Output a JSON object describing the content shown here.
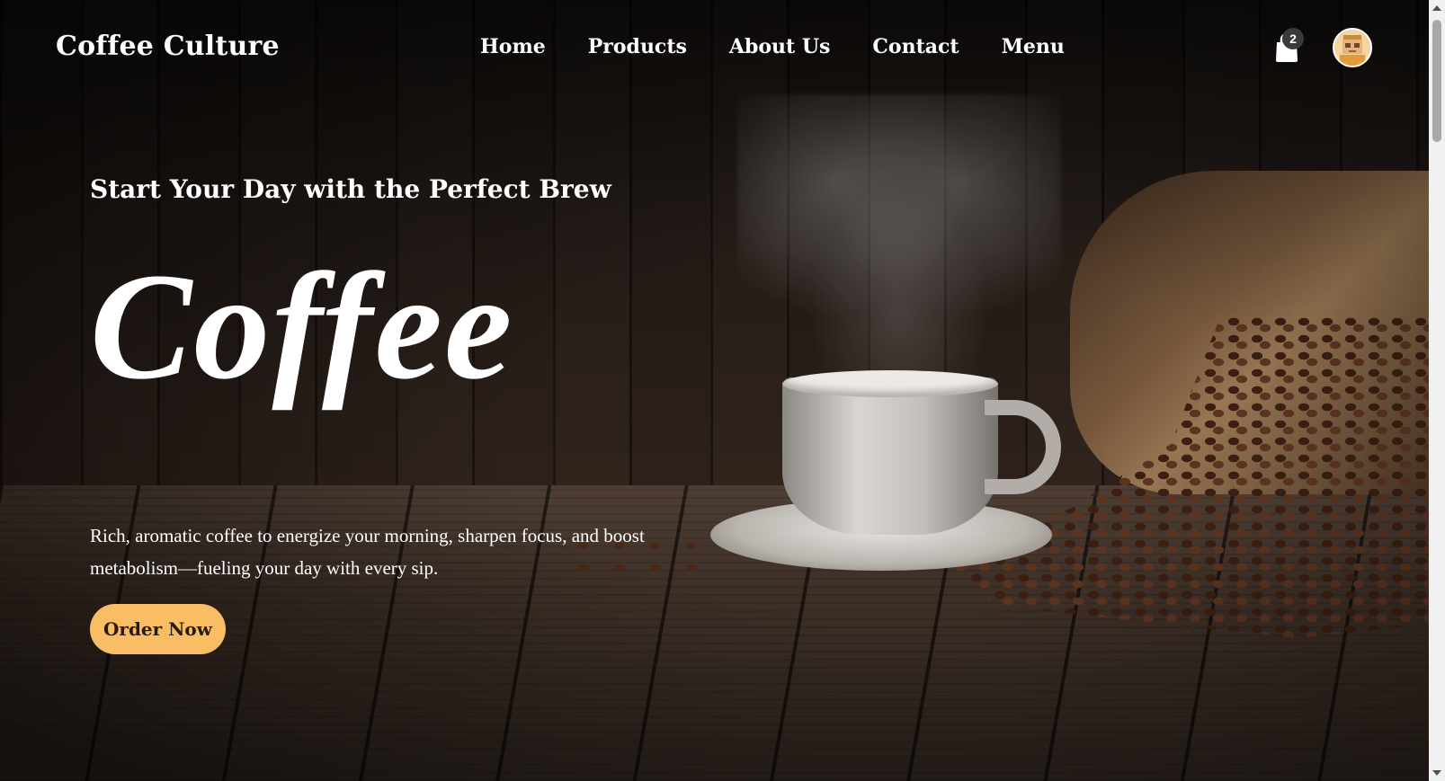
{
  "brand": {
    "name": "Coffee Culture"
  },
  "nav": {
    "items": [
      {
        "label": "Home"
      },
      {
        "label": "Products"
      },
      {
        "label": "About Us"
      },
      {
        "label": "Contact"
      },
      {
        "label": "Menu"
      }
    ]
  },
  "cart": {
    "count": "2",
    "icon": "shopping-bag-icon"
  },
  "user": {
    "avatar_icon": "avatar-icon"
  },
  "hero": {
    "subtitle": "Start Your Day with the Perfect Brew",
    "title": "Coffee",
    "description": "Rich, aromatic coffee to energize your morning, sharpen focus, and boost metabolism—fueling your day with every sip.",
    "cta_label": "Order Now"
  },
  "colors": {
    "accent": "#f9bd63",
    "text": "#ffffff",
    "background": "#1a120d"
  }
}
